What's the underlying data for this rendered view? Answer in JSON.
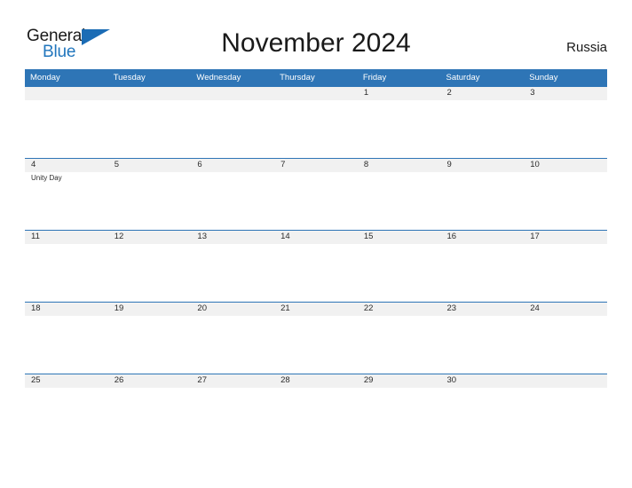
{
  "brand": {
    "name_part1": "General",
    "name_part2": "Blue",
    "flag_icon": "flag-triangle-icon",
    "colors": {
      "general_text": "#1a1a1a",
      "blue_text": "#2176bd",
      "flag": "#1b6cb5"
    }
  },
  "header": {
    "title": "November 2024",
    "country": "Russia"
  },
  "theme": {
    "header_blue": "#2e75b6",
    "week_band_gray": "#f1f1f1",
    "page_background": "#ffffff",
    "text": "#2b2b2b"
  },
  "calendar": {
    "weekday_headers": [
      "Monday",
      "Tuesday",
      "Wednesday",
      "Thursday",
      "Friday",
      "Saturday",
      "Sunday"
    ],
    "weeks": [
      {
        "days": [
          {
            "num": "",
            "events": []
          },
          {
            "num": "",
            "events": []
          },
          {
            "num": "",
            "events": []
          },
          {
            "num": "",
            "events": []
          },
          {
            "num": "1",
            "events": []
          },
          {
            "num": "2",
            "events": []
          },
          {
            "num": "3",
            "events": []
          }
        ]
      },
      {
        "days": [
          {
            "num": "4",
            "events": [
              "Unity Day"
            ]
          },
          {
            "num": "5",
            "events": []
          },
          {
            "num": "6",
            "events": []
          },
          {
            "num": "7",
            "events": []
          },
          {
            "num": "8",
            "events": []
          },
          {
            "num": "9",
            "events": []
          },
          {
            "num": "10",
            "events": []
          }
        ]
      },
      {
        "days": [
          {
            "num": "11",
            "events": []
          },
          {
            "num": "12",
            "events": []
          },
          {
            "num": "13",
            "events": []
          },
          {
            "num": "14",
            "events": []
          },
          {
            "num": "15",
            "events": []
          },
          {
            "num": "16",
            "events": []
          },
          {
            "num": "17",
            "events": []
          }
        ]
      },
      {
        "days": [
          {
            "num": "18",
            "events": []
          },
          {
            "num": "19",
            "events": []
          },
          {
            "num": "20",
            "events": []
          },
          {
            "num": "21",
            "events": []
          },
          {
            "num": "22",
            "events": []
          },
          {
            "num": "23",
            "events": []
          },
          {
            "num": "24",
            "events": []
          }
        ]
      },
      {
        "days": [
          {
            "num": "25",
            "events": []
          },
          {
            "num": "26",
            "events": []
          },
          {
            "num": "27",
            "events": []
          },
          {
            "num": "28",
            "events": []
          },
          {
            "num": "29",
            "events": []
          },
          {
            "num": "30",
            "events": []
          },
          {
            "num": "",
            "events": []
          }
        ]
      }
    ]
  }
}
